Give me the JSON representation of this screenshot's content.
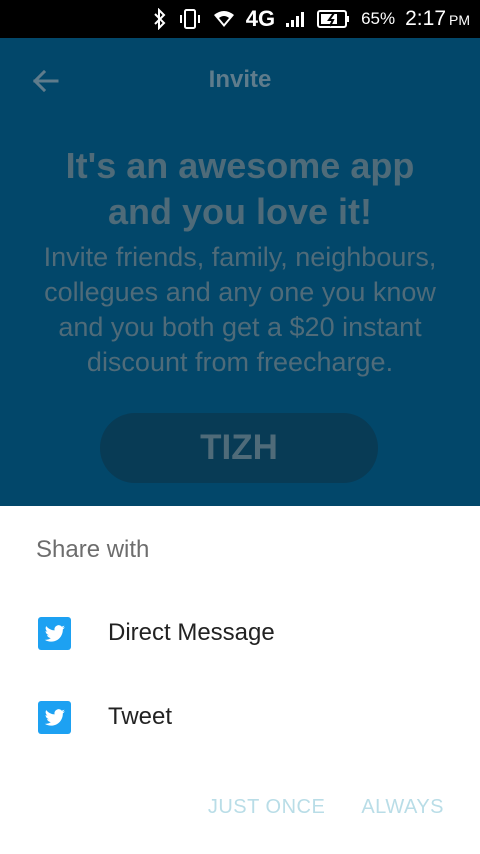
{
  "status": {
    "network": "4G",
    "battery": "65%",
    "time": "2:17",
    "ampm": "PM",
    "icons": [
      "bluetooth-icon",
      "vibrate-icon",
      "wifi-icon",
      "signal-icon",
      "battery-icon"
    ]
  },
  "toolbar": {
    "title": "Invite",
    "back_icon": "arrow-left-icon"
  },
  "invite": {
    "headline_line1": "It's an awesome app",
    "headline_line2": "and you love it!",
    "description_lines": [
      "Invite friends, family, neighbours,",
      "collegues and any one you know",
      "and you both get a $20 instant",
      "discount from freecharge."
    ],
    "code": "TIZH"
  },
  "share_sheet": {
    "title": "Share with",
    "items": [
      {
        "label": "Direct Message",
        "icon": "twitter-icon"
      },
      {
        "label": "Tweet",
        "icon": "twitter-icon"
      }
    ],
    "actions": {
      "just_once": "JUST ONCE",
      "always": "ALWAYS"
    }
  },
  "colors": {
    "app_background": "#02476a",
    "status_bar": "#000000",
    "sheet_background": "#ffffff",
    "twitter_blue": "#1da1f2",
    "action_text": "#b9dde7"
  }
}
